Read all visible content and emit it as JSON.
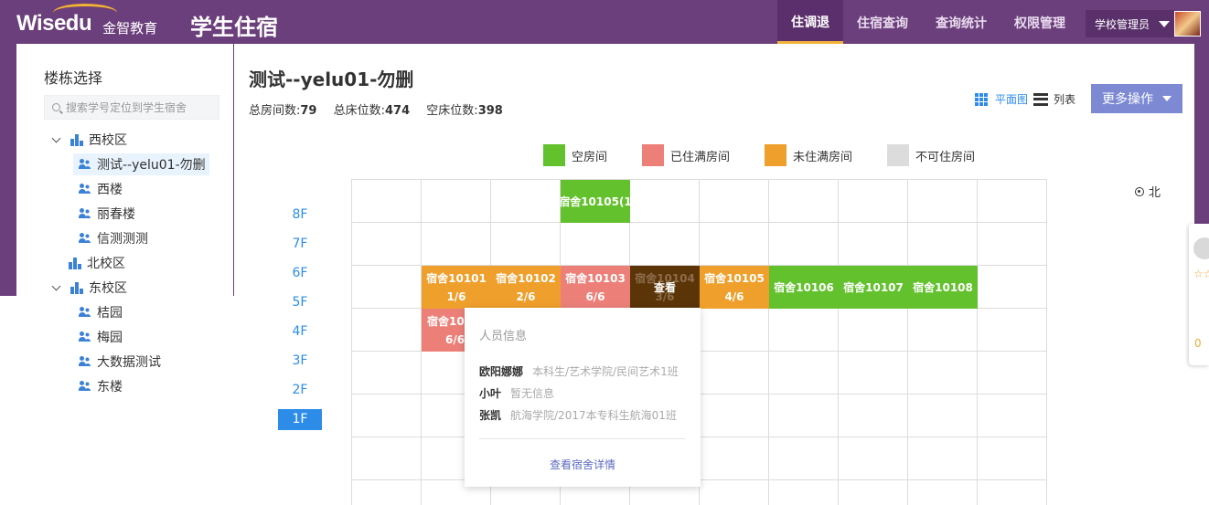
{
  "header": {
    "logo_text": "Wisedu",
    "brand_cn": "金智教育",
    "app_title": "学生住宿",
    "nav": [
      {
        "label": "住调退",
        "active": true
      },
      {
        "label": "住宿查询",
        "active": false
      },
      {
        "label": "查询统计",
        "active": false
      },
      {
        "label": "权限管理",
        "active": false
      }
    ],
    "user_role": "学校管理员"
  },
  "sidebar": {
    "title": "楼栋选择",
    "search_placeholder": "搜索学号定位到学生宿舍",
    "tree": [
      {
        "label": "西校区",
        "type": "campus",
        "expanded": true
      },
      {
        "label": "测试--yelu01-勿删",
        "type": "building",
        "selected": true
      },
      {
        "label": "西楼",
        "type": "building"
      },
      {
        "label": "丽春楼",
        "type": "building"
      },
      {
        "label": "信测测测",
        "type": "building"
      },
      {
        "label": "北校区",
        "type": "campus",
        "expanded": false
      },
      {
        "label": "东校区",
        "type": "campus",
        "expanded": true
      },
      {
        "label": "桔园",
        "type": "building"
      },
      {
        "label": "梅园",
        "type": "building"
      },
      {
        "label": "大数据测试",
        "type": "building"
      },
      {
        "label": "东楼",
        "type": "building"
      }
    ]
  },
  "main": {
    "title": "测试--yelu01-勿删",
    "stats": {
      "rooms_label": "总房间数:",
      "rooms": "79",
      "beds_label": "总床位数:",
      "beds": "474",
      "empty_label": "空床位数:",
      "empty": "398"
    },
    "view_toggle": {
      "plan": "平面图",
      "list": "列表"
    },
    "more_button": "更多操作",
    "legend": [
      {
        "label": "空房间",
        "color": "#62c12c"
      },
      {
        "label": "已住满房间",
        "color": "#ec8079"
      },
      {
        "label": "未住满房间",
        "color": "#ef9f2b"
      },
      {
        "label": "不可住房间",
        "color": "#dcdcdc"
      }
    ],
    "north_label": "北",
    "floors": [
      "8F",
      "7F",
      "6F",
      "5F",
      "4F",
      "3F",
      "2F",
      "1F"
    ],
    "active_floor": "1F",
    "rooms": [
      {
        "name": "宿舍10105(1",
        "occupancy": "",
        "status": "empty"
      },
      {
        "name": "宿舍10101",
        "occupancy": "1/6",
        "status": "partial"
      },
      {
        "name": "宿舍10102",
        "occupancy": "2/6",
        "status": "partial"
      },
      {
        "name": "宿舍10103",
        "occupancy": "6/6",
        "status": "full"
      },
      {
        "name": "宿舍10104",
        "occupancy": "3/6",
        "status": "hover",
        "overlay": "查看"
      },
      {
        "name": "宿舍10105",
        "occupancy": "4/6",
        "status": "partial"
      },
      {
        "name": "宿舍10106",
        "occupancy": "",
        "status": "empty"
      },
      {
        "name": "宿舍10107",
        "occupancy": "",
        "status": "empty"
      },
      {
        "name": "宿舍10108",
        "occupancy": "",
        "status": "empty"
      },
      {
        "name": "宿舍10",
        "occupancy": "6/6",
        "status": "full"
      }
    ],
    "popup": {
      "title": "人员信息",
      "people": [
        {
          "name": "欧阳娜娜",
          "info": "本科生/艺术学院/民间艺术1班"
        },
        {
          "name": "小叶",
          "info": "暂无信息"
        },
        {
          "name": "张凯",
          "info": "航海学院/2017本专科生航海01班"
        }
      ],
      "link": "查看宿舍详情"
    }
  },
  "side_widget": {
    "stars": "☆☆☆☆☆",
    "score": "0"
  }
}
